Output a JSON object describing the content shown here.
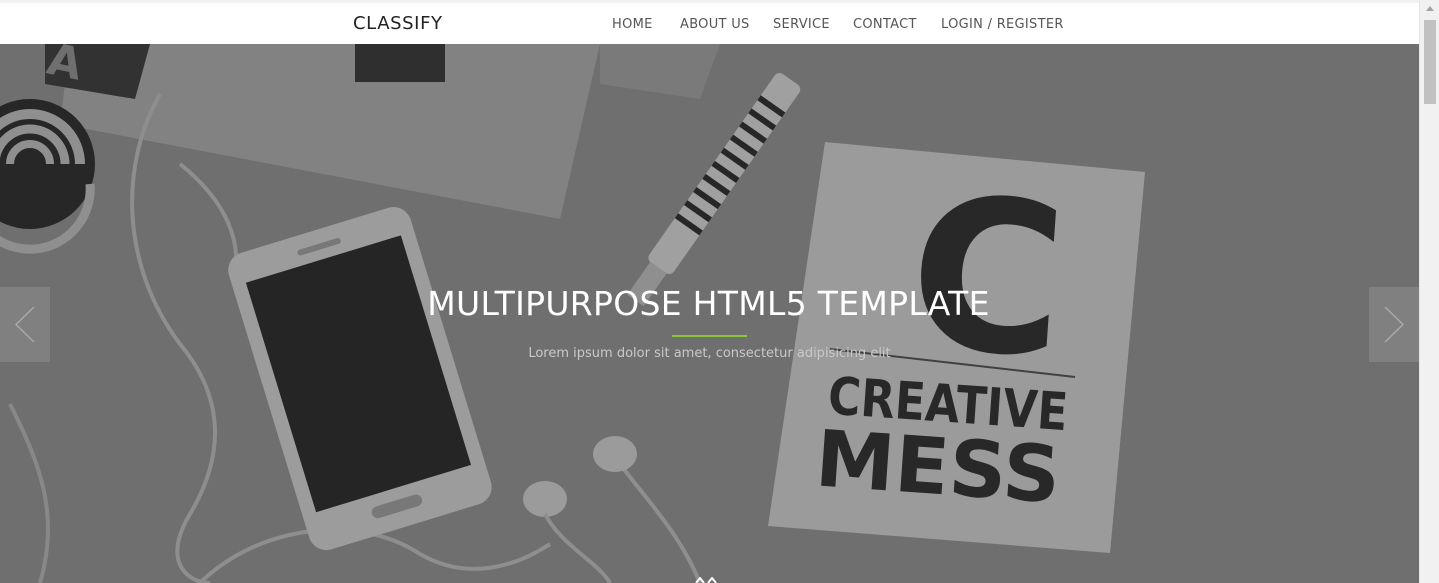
{
  "navbar": {
    "brand": "CLASSIFY",
    "items": [
      {
        "label": "HOME"
      },
      {
        "label": "ABOUT US"
      },
      {
        "label": "SERVICE"
      },
      {
        "label": "CONTACT"
      },
      {
        "label": "LOGIN / REGISTER"
      }
    ]
  },
  "hero": {
    "title": "MULTIPURPOSE HTML5 TEMPLATE",
    "subtitle": "Lorem ipsum dolor sit amet, consectetur adipisicing elit",
    "notebook_big_letter": "C",
    "notebook_text_1": "CREATIVE",
    "notebook_text_2": "MESS",
    "top_left_fragment": "A",
    "prev_icon": "chevron-left-icon",
    "next_icon": "chevron-right-icon"
  },
  "colors": {
    "accent": "#8dc63f",
    "overlay": "#6e6e6e",
    "nav_text": "#555555",
    "brand_text": "#222222"
  }
}
